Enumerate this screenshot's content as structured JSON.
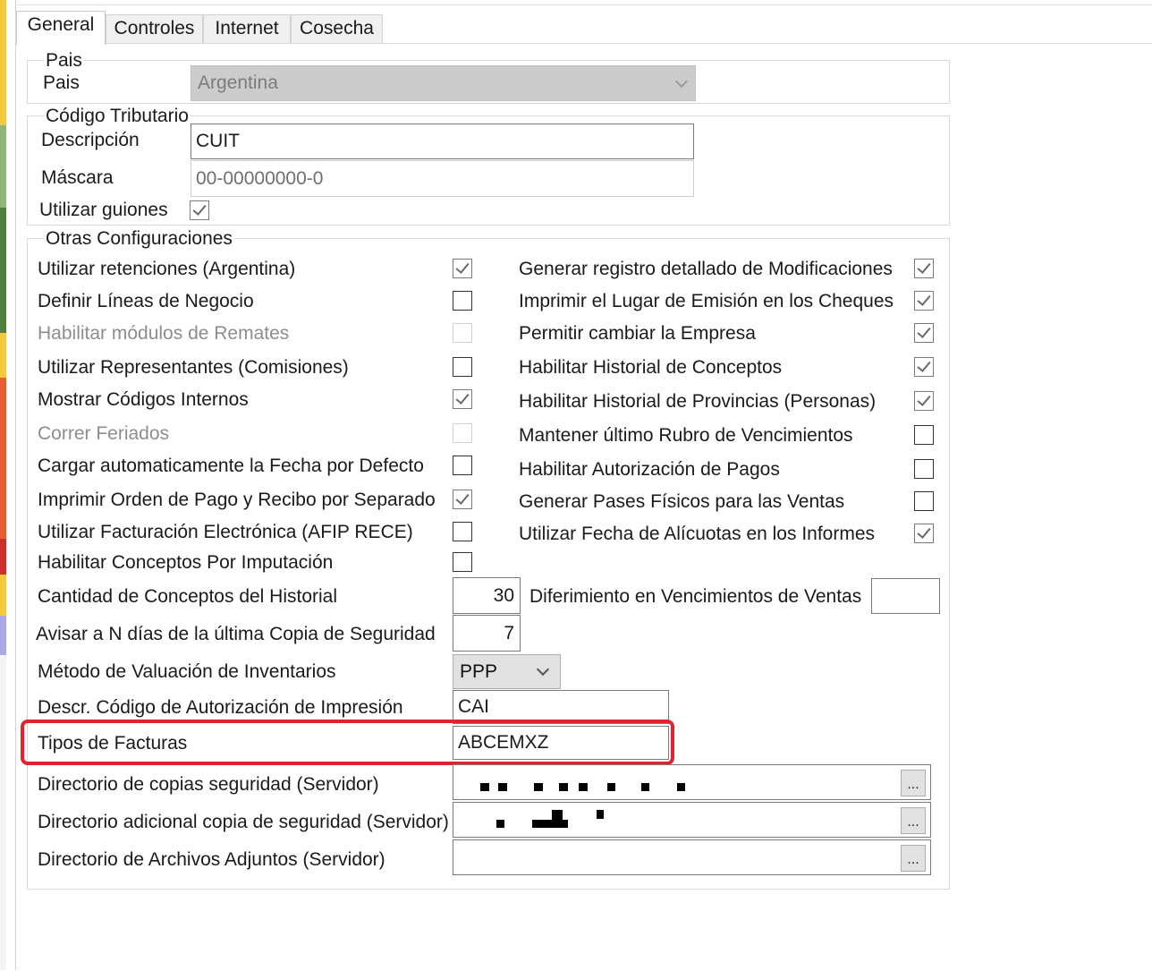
{
  "tabs": [
    {
      "label": "General",
      "active": true
    },
    {
      "label": "Controles",
      "active": false
    },
    {
      "label": "Internet",
      "active": false
    },
    {
      "label": "Cosecha",
      "active": false
    }
  ],
  "pais_group": {
    "legend": "Pais",
    "label": "Pais",
    "value": "Argentina"
  },
  "codigo_group": {
    "legend": "Código Tributario",
    "descripcion_label": "Descripción",
    "descripcion_value": "CUIT",
    "mascara_label": "Máscara",
    "mascara_value": "00-00000000-0",
    "guiones_label": "Utilizar guiones",
    "guiones_checked": true
  },
  "otras_group": {
    "legend": "Otras Configuraciones",
    "left_items": [
      {
        "label": "Utilizar retenciones (Argentina)",
        "checked": true,
        "enabled": true
      },
      {
        "label": "Definir Líneas de Negocio",
        "checked": false,
        "enabled": true
      },
      {
        "label": "Habilitar módulos de Remates",
        "checked": false,
        "enabled": false
      },
      {
        "label": "Utilizar Representantes (Comisiones)",
        "checked": false,
        "enabled": true
      },
      {
        "label": "Mostrar Códigos Internos",
        "checked": true,
        "enabled": true
      },
      {
        "label": "Correr Feriados",
        "checked": false,
        "enabled": false
      },
      {
        "label": "Cargar automaticamente la Fecha por Defecto",
        "checked": false,
        "enabled": true
      },
      {
        "label": "Imprimir Orden de Pago y Recibo por Separado",
        "checked": true,
        "enabled": true
      },
      {
        "label": "Utilizar Facturación Electrónica (AFIP RECE)",
        "checked": false,
        "enabled": true
      },
      {
        "label": "Habilitar Conceptos Por Imputación",
        "checked": false,
        "enabled": true
      }
    ],
    "right_items": [
      {
        "label": "Generar registro detallado de Modificaciones",
        "checked": true
      },
      {
        "label": "Imprimir el Lugar de Emisión en los Cheques",
        "checked": true
      },
      {
        "label": "Permitir cambiar la Empresa",
        "checked": true
      },
      {
        "label": "Habilitar Historial de Conceptos",
        "checked": true
      },
      {
        "label": "Habilitar Historial de Provincias (Personas)",
        "checked": true
      },
      {
        "label": "Mantener último Rubro de Vencimientos",
        "checked": false
      },
      {
        "label": "Habilitar Autorización de Pagos",
        "checked": false
      },
      {
        "label": "Generar Pases Físicos para las Ventas",
        "checked": false
      },
      {
        "label": "Utilizar Fecha de Alícuotas en los Informes",
        "checked": true
      }
    ],
    "cantidad_label": "Cantidad de Conceptos del Historial",
    "cantidad_value": "30",
    "diferimiento_label": "Diferimiento en Vencimientos de Ventas",
    "diferimiento_value": "",
    "avisar_label": "Avisar a N días de la última Copia de Seguridad",
    "avisar_value": "7",
    "metodo_label": "Método de Valuación de Inventarios",
    "metodo_value": "PPP",
    "descr_cai_label": "Descr. Código de Autorización de Impresión",
    "descr_cai_value": "CAI",
    "tipos_label": "Tipos de Facturas",
    "tipos_value": "ABCEMXZ",
    "dir_copias_label": "Directorio de copias seguridad (Servidor)",
    "dir_adicional_label": "Directorio adicional copia de seguridad (Servidor)",
    "dir_adjuntos_label": "Directorio de Archivos Adjuntos (Servidor)",
    "browse_label": "...",
    "highlight_color": "#e0232f"
  }
}
